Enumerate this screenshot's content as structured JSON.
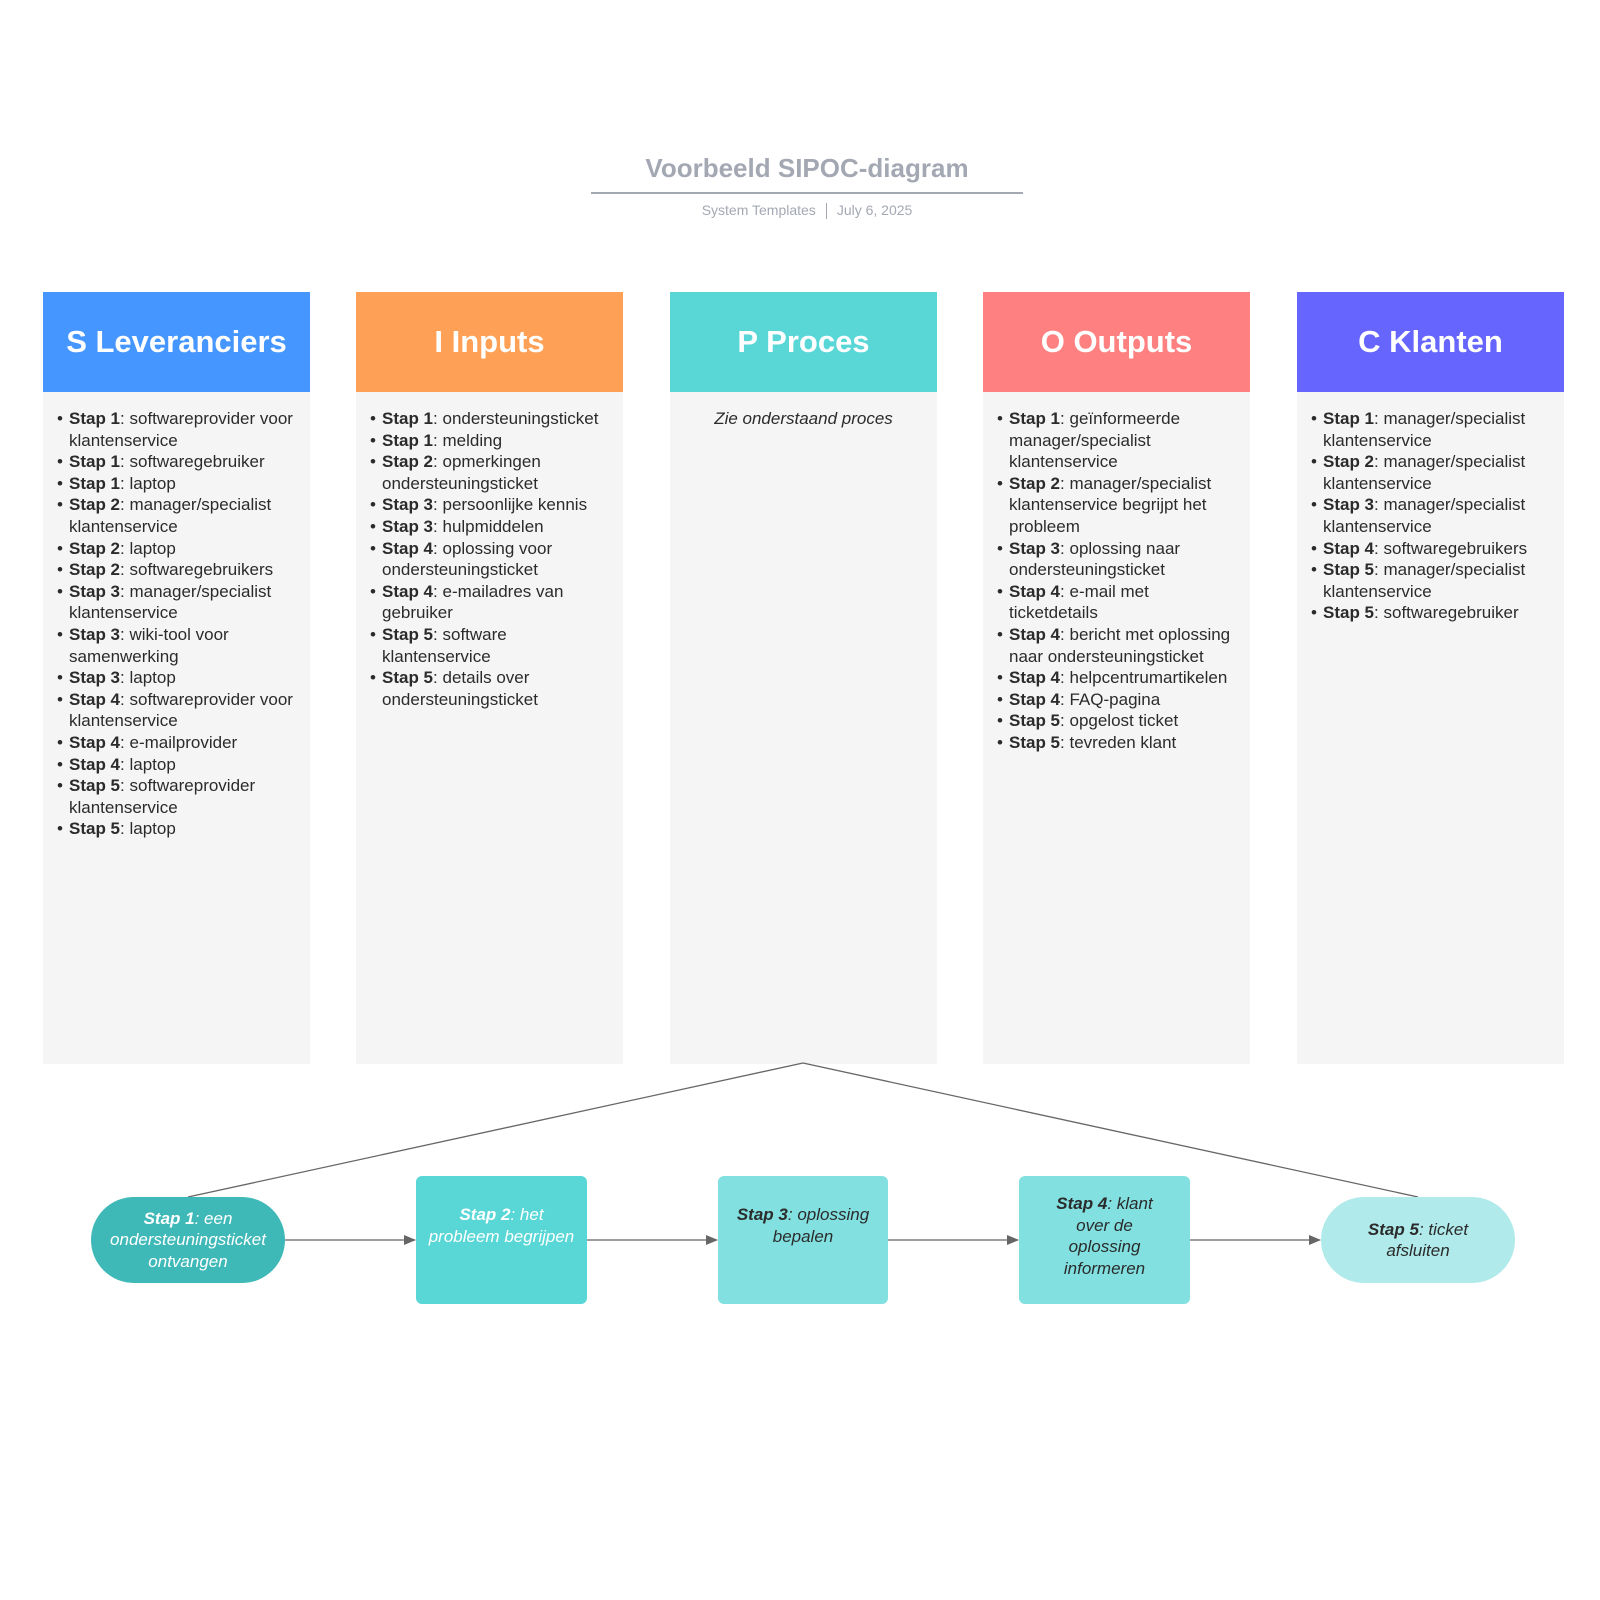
{
  "header": {
    "title": "Voorbeeld SIPOC-diagram",
    "author": "System Templates",
    "date": "July 6, 2025"
  },
  "colors": {
    "suppliers": "#4596ff",
    "inputs": "#ffa057",
    "process": "#59d6d6",
    "outputs": "#ff8080",
    "customers": "#6666ff",
    "column_bg": "#f5f5f5",
    "step1": "#3fb8b8",
    "step2": "#59d6d6",
    "step3": "#82e0e0",
    "step4": "#82e0e0",
    "step5": "#b0eaea",
    "connector": "#666666"
  },
  "columns": {
    "suppliers": {
      "title": "S Leveranciers",
      "items": [
        {
          "step": "Stap 1",
          "text": " softwareprovider voor klantenservice"
        },
        {
          "step": "Stap 1",
          "text": " softwaregebruiker"
        },
        {
          "step": "Stap 1",
          "text": " laptop"
        },
        {
          "step": "Stap 2",
          "text": " manager/specialist klantenservice"
        },
        {
          "step": "Stap 2",
          "text": " laptop"
        },
        {
          "step": "Stap 2",
          "text": " softwaregebruikers"
        },
        {
          "step": "Stap 3",
          "text": " manager/specialist klantenservice"
        },
        {
          "step": "Stap 3",
          "text": " wiki-tool voor samenwerking"
        },
        {
          "step": "Stap 3",
          "text": " laptop"
        },
        {
          "step": "Stap 4",
          "text": " softwareprovider voor klantenservice"
        },
        {
          "step": "Stap 4",
          "text": " e-mailprovider"
        },
        {
          "step": "Stap 4",
          "text": " laptop"
        },
        {
          "step": "Stap 5",
          "text": " softwareprovider klantenservice"
        },
        {
          "step": "Stap 5",
          "text": " laptop"
        }
      ]
    },
    "inputs": {
      "title": "I Inputs",
      "items": [
        {
          "step": "Stap 1",
          "text": " ondersteuningsticket"
        },
        {
          "step": "Stap 1",
          "text": " melding"
        },
        {
          "step": "Stap 2",
          "text": " opmerkingen ondersteuningsticket"
        },
        {
          "step": "Stap 3",
          "text": " persoonlijke kennis"
        },
        {
          "step": "Stap 3",
          "text": " hulpmiddelen"
        },
        {
          "step": "Stap 4",
          "text": " oplossing voor ondersteuningsticket"
        },
        {
          "step": "Stap 4",
          "text": " e-mailadres van gebruiker"
        },
        {
          "step": "Stap 5",
          "text": " software klantenservice"
        },
        {
          "step": "Stap 5",
          "text": " details over ondersteuningsticket"
        }
      ]
    },
    "process": {
      "title": "P Proces",
      "note": "Zie onderstaand proces"
    },
    "outputs": {
      "title": "O Outputs",
      "items": [
        {
          "step": "Stap 1",
          "text": " geïnformeerde manager/specialist klantenservice"
        },
        {
          "step": "Stap 2",
          "text": " manager/specialist klantenservice begrijpt het probleem"
        },
        {
          "step": "Stap 3",
          "text": " oplossing naar ondersteuningsticket"
        },
        {
          "step": "Stap 4",
          "text": " e-mail met ticketdetails"
        },
        {
          "step": "Stap 4",
          "text": " bericht met oplossing naar ondersteuningsticket"
        },
        {
          "step": "Stap 4",
          "text": " helpcentrumartikelen"
        },
        {
          "step": "Stap 4",
          "text": " FAQ-pagina"
        },
        {
          "step": "Stap 5",
          "text": " opgelost ticket"
        },
        {
          "step": "Stap 5",
          "text": " tevreden klant"
        }
      ]
    },
    "customers": {
      "title": "C Klanten",
      "items": [
        {
          "step": "Stap 1",
          "text": " manager/specialist klantenservice"
        },
        {
          "step": "Stap 2",
          "text": " manager/specialist klantenservice"
        },
        {
          "step": "Stap 3",
          "text": " manager/specialist klantenservice"
        },
        {
          "step": "Stap 4",
          "text": " softwaregebruikers"
        },
        {
          "step": "Stap 5",
          "text": " manager/specialist klantenservice"
        },
        {
          "step": "Stap 5",
          "text": " softwaregebruiker"
        }
      ]
    }
  },
  "process_flow": {
    "steps": [
      {
        "label": "Stap 1",
        "text": ": een ondersteuningsticket ontvangen",
        "shape": "pill",
        "text_color": "#ffffff"
      },
      {
        "label": "Stap 2",
        "text": ": het probleem begrijpen",
        "shape": "box",
        "text_color": "#ffffff"
      },
      {
        "label": "Stap 3",
        "text": ": oplossing bepalen",
        "shape": "box",
        "text_color": "#2b2b2b"
      },
      {
        "label": "Stap 4",
        "text": ": klant over de oplossing informeren",
        "shape": "box",
        "text_color": "#2b2b2b"
      },
      {
        "label": "Stap 5",
        "text": ": ticket afsluiten",
        "shape": "pill",
        "text_color": "#2b2b2b"
      }
    ]
  }
}
